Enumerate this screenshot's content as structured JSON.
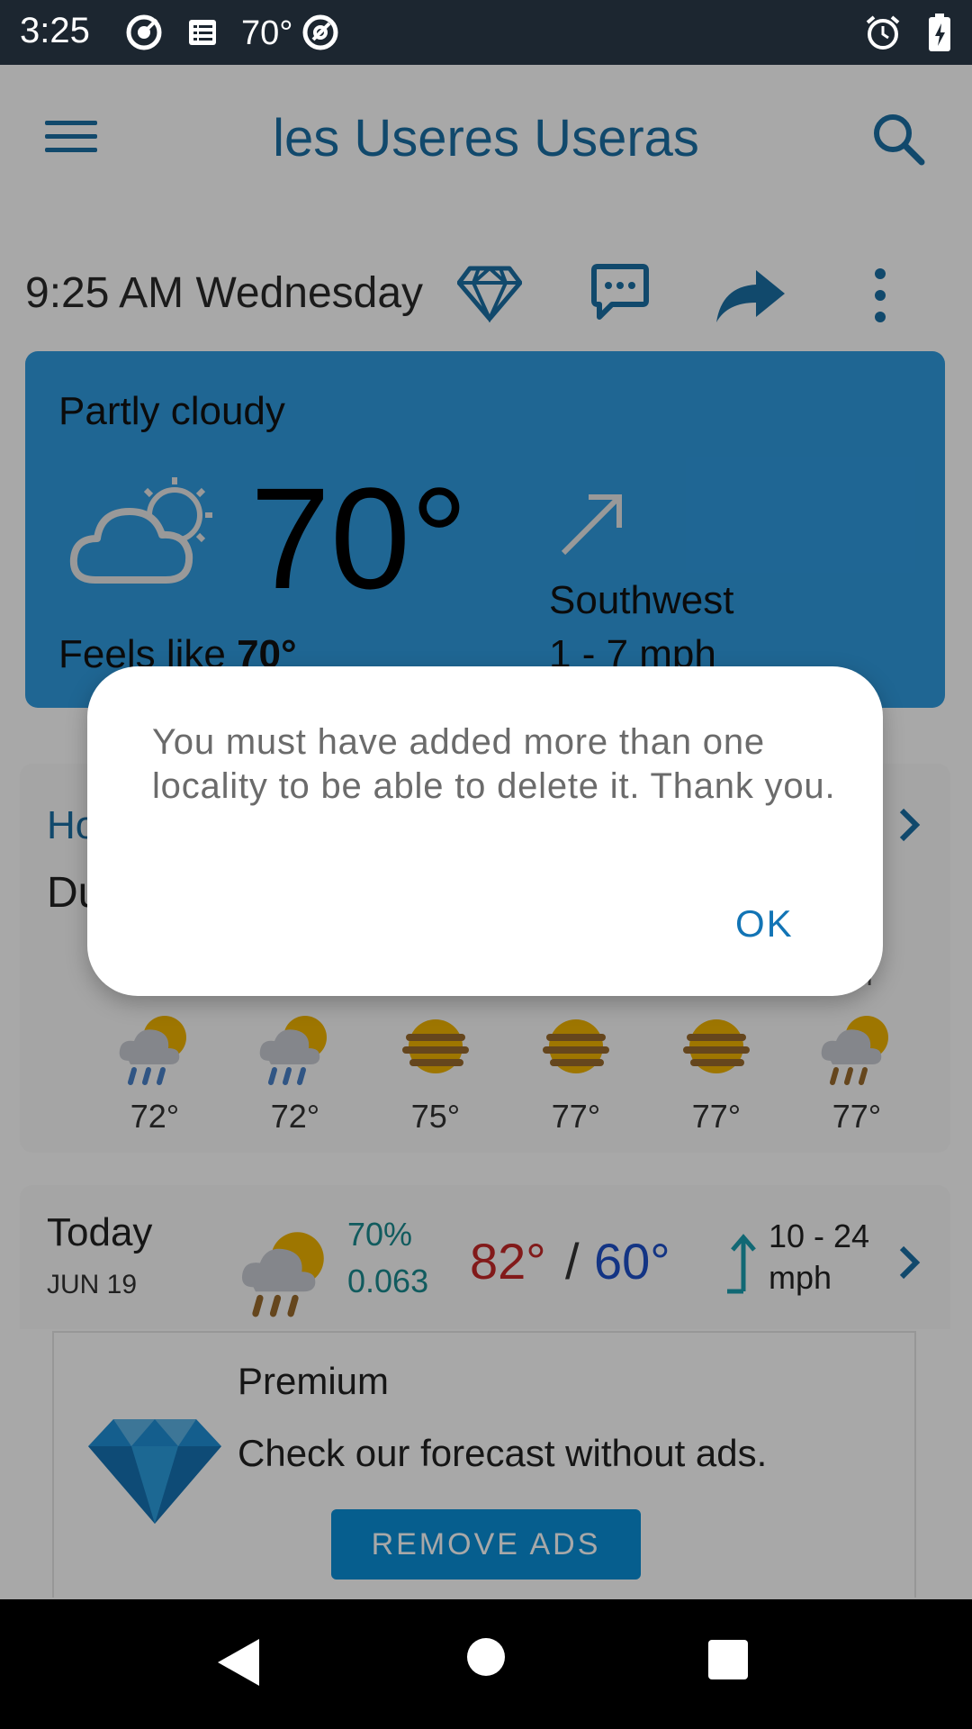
{
  "status_bar": {
    "time": "3:25",
    "temp": "70°",
    "icons": [
      "target-icon",
      "list-icon",
      "at-icon",
      "alarm-icon",
      "battery-charging-icon"
    ]
  },
  "app_bar": {
    "title": "les Useres Useras",
    "menu_icon": "menu-icon",
    "search_icon": "search-icon"
  },
  "toolbar": {
    "datetime": "9:25 AM  Wednesday",
    "icons": [
      "diamond-icon",
      "chat-icon",
      "share-icon",
      "more-vert-icon"
    ]
  },
  "current": {
    "condition": "Partly cloudy",
    "temperature": "70°",
    "feels_like_label": "Feels like",
    "feels_like_value": "70°",
    "wind_direction": "Southwest",
    "wind_speed": "1 - 7 mph"
  },
  "hourly": {
    "title_partial": "Ho",
    "subtitle_partial": "Du",
    "am_label": "M",
    "hours": [
      {
        "temp": "72°",
        "icon": "rain-partly-sunny-icon"
      },
      {
        "temp": "72°",
        "icon": "rain-partly-sunny-icon"
      },
      {
        "temp": "75°",
        "icon": "haze-sun-icon"
      },
      {
        "temp": "77°",
        "icon": "haze-sun-icon"
      },
      {
        "temp": "77°",
        "icon": "haze-sun-icon"
      },
      {
        "temp": "77°",
        "icon": "drizzle-partly-sunny-icon"
      }
    ]
  },
  "daily": {
    "day": "Today",
    "date": "JUN 19",
    "precip_chance": "70%",
    "precip_amount": "0.063",
    "high": "82°",
    "separator": "/",
    "low": "60°",
    "wind_line1": "10 - 24",
    "wind_line2": "mph"
  },
  "premium": {
    "title": "Premium",
    "text": "Check our forecast without ads.",
    "button": "REMOVE ADS"
  },
  "dialog": {
    "message": "You must have added more than one locality to be able to delete it. Thank you.",
    "ok_label": "OK"
  },
  "colors": {
    "accent": "#1b6fa5",
    "card_blue": "#2f9be0",
    "high_temp": "#c62828",
    "low_temp": "#1e4fc9",
    "precip": "#1a8a8f",
    "button": "#0a8fd8"
  }
}
